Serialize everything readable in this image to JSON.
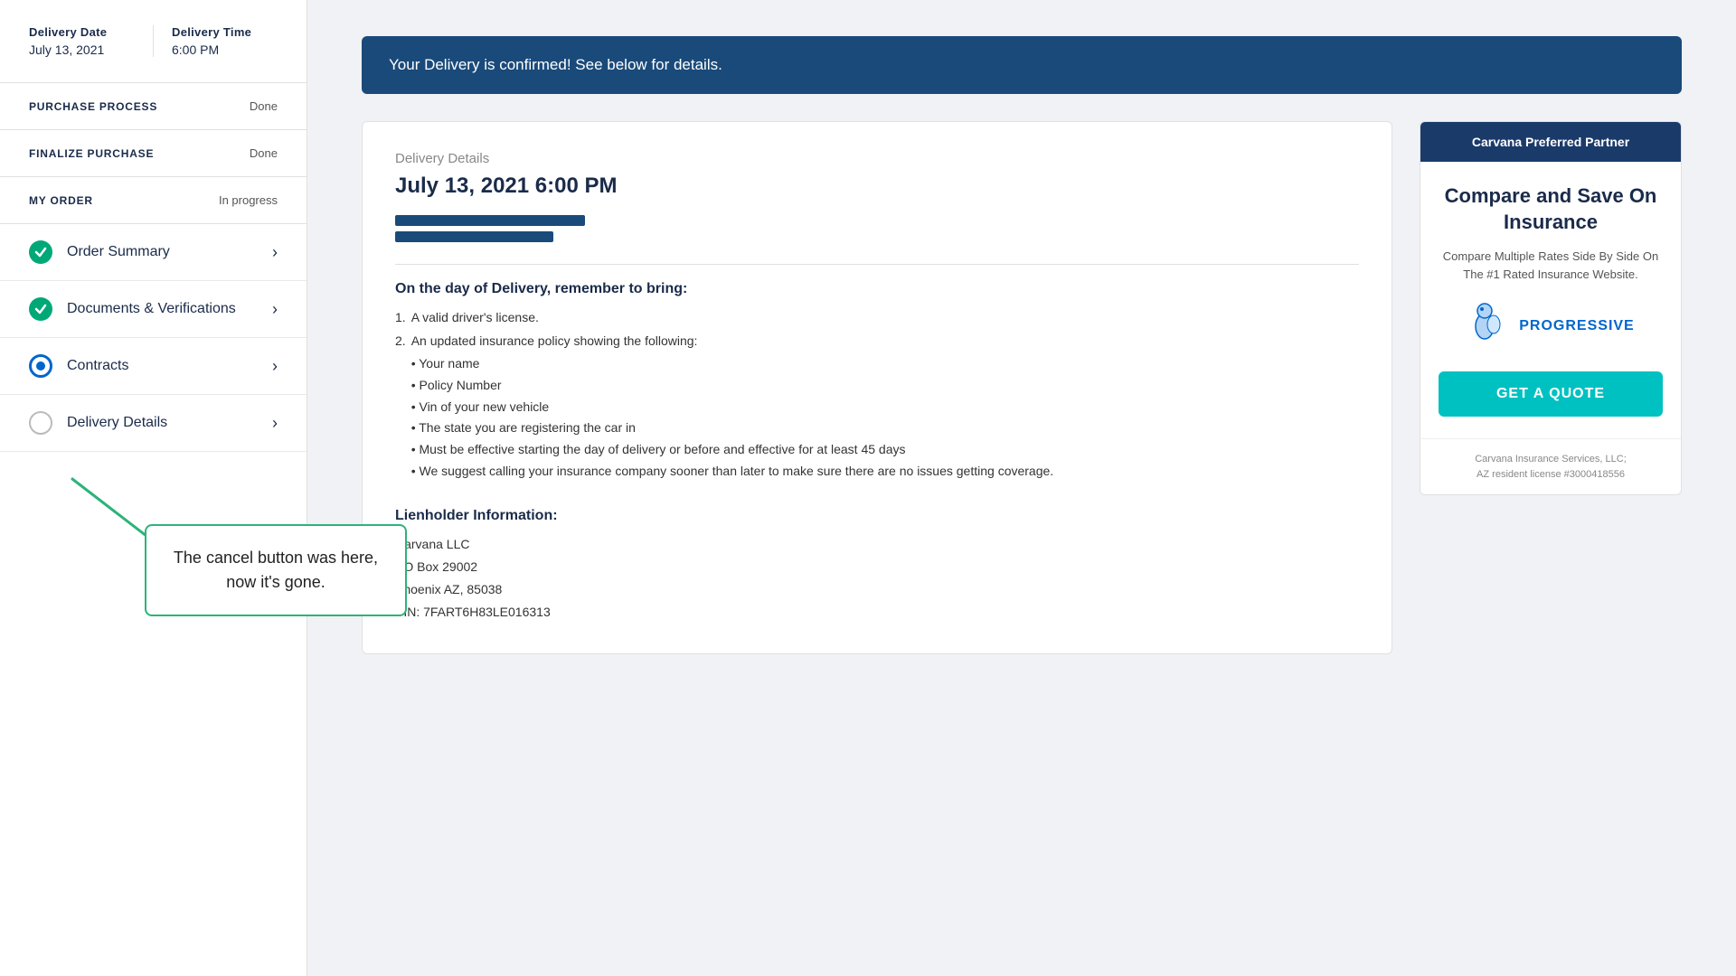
{
  "sidebar": {
    "delivery_date_label": "Delivery Date",
    "delivery_date_value": "July 13, 2021",
    "delivery_time_label": "Delivery Time",
    "delivery_time_value": "6:00 PM",
    "sections": [
      {
        "id": "purchase-process",
        "label": "PURCHASE PROCESS",
        "status": "Done"
      },
      {
        "id": "finalize-purchase",
        "label": "FINALIZE PURCHASE",
        "status": "Done"
      },
      {
        "id": "my-order",
        "label": "MY ORDER",
        "status": "In progress"
      }
    ],
    "nav_items": [
      {
        "id": "order-summary",
        "label": "Order Summary",
        "icon": "check"
      },
      {
        "id": "documents-verifications",
        "label": "Documents & Verifications",
        "icon": "check"
      },
      {
        "id": "contracts",
        "label": "Contracts",
        "icon": "dot-filled"
      },
      {
        "id": "delivery-details",
        "label": "Delivery Details",
        "icon": "dot-empty"
      }
    ]
  },
  "annotation": {
    "text": "The cancel button was here, now it's gone."
  },
  "main": {
    "banner": "Your Delivery is confirmed! See below for details.",
    "delivery_details": {
      "title": "Delivery Details",
      "datetime": "July 13, 2021 6:00 PM",
      "bring_title": "On the day of Delivery, remember to bring:",
      "bring_items": [
        "A valid driver's license.",
        "An updated insurance policy showing the following:"
      ],
      "insurance_subitems": [
        "Your name",
        "Policy Number",
        "Vin of your new vehicle",
        "The state you are registering the car in",
        "Must be effective starting the day of delivery or before and effective for at least 45 days",
        "We suggest calling your insurance company sooner than later to make sure there are no issues getting coverage."
      ],
      "lienholder_title": "Lienholder Information:",
      "lienholder_name": "Carvana LLC",
      "lienholder_po": "PO Box 29002",
      "lienholder_city": "Phoenix AZ, 85038",
      "lienholder_vin": "VIN: 7FART6H83LE016313"
    },
    "insurance": {
      "header": "Carvana Preferred Partner",
      "title": "Compare and Save On Insurance",
      "description": "Compare Multiple Rates Side By Side On The #1 Rated Insurance Website.",
      "logo_text": "PROGRESSIVE",
      "cta_label": "GET A QUOTE",
      "footer_line1": "Carvana Insurance Services, LLC;",
      "footer_line2": "AZ resident license #3000418556"
    }
  }
}
